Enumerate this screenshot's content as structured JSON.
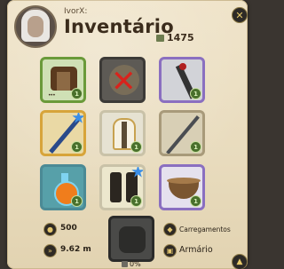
{
  "header": {
    "player_name": "IvorX:",
    "title": "Inventário",
    "weight": "1475",
    "weight_icon": "weight-icon",
    "close_icon": "close-icon"
  },
  "slots": [
    {
      "name": "Leather jacket",
      "tier": "1",
      "dots": "•••"
    },
    {
      "name": "Empty slot - blocked",
      "tier": ""
    },
    {
      "name": "Dagger",
      "tier": "1"
    },
    {
      "name": "Staff",
      "tier": "1"
    },
    {
      "name": "Robe",
      "tier": "1"
    },
    {
      "name": "Spear",
      "tier": "1"
    },
    {
      "name": "Potion",
      "tier": "1"
    },
    {
      "name": "Boots",
      "tier": "1"
    },
    {
      "name": "Stew",
      "tier": "1"
    }
  ],
  "stats": {
    "silver": "500",
    "weight_speed": "9.62 m",
    "loading_label": "Carregamentos",
    "wardrobe_label": "Armário",
    "percent": "0%"
  }
}
